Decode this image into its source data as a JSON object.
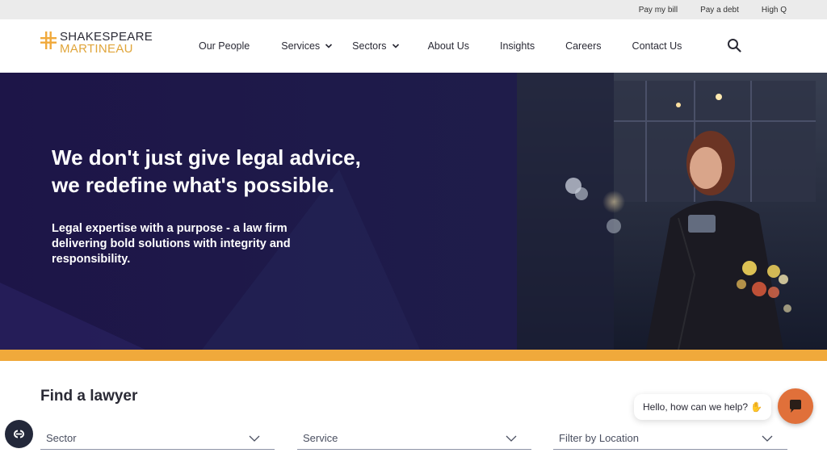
{
  "utility": {
    "links": [
      "Pay my bill",
      "Pay a debt",
      "High Q"
    ]
  },
  "brand": {
    "line1": "SHAKESPEARE",
    "line2": "MARTINEAU",
    "accent_color": "#f0a93b",
    "dark_color": "#2a2a35"
  },
  "nav": {
    "items": [
      {
        "label": "Our People",
        "has_dropdown": false
      },
      {
        "label": "Services",
        "has_dropdown": true
      },
      {
        "label": "Sectors",
        "has_dropdown": true
      },
      {
        "label": "About Us",
        "has_dropdown": false
      },
      {
        "label": "Insights",
        "has_dropdown": false
      },
      {
        "label": "Careers",
        "has_dropdown": false
      },
      {
        "label": "Contact Us",
        "has_dropdown": false
      }
    ],
    "search_icon": "search-icon"
  },
  "hero": {
    "title_line1": "We don't just give legal advice,",
    "title_line2": "we redefine what's possible.",
    "subtitle": "Legal expertise with a purpose - a law firm delivering bold solutions with integrity and responsibility."
  },
  "find_lawyer": {
    "title": "Find a lawyer",
    "filters": [
      {
        "label": "Sector"
      },
      {
        "label": "Service"
      },
      {
        "label": "Filter by Location"
      }
    ]
  },
  "chat": {
    "greeting": "Hello, how can we help?",
    "launcher_color": "#e0703a"
  }
}
